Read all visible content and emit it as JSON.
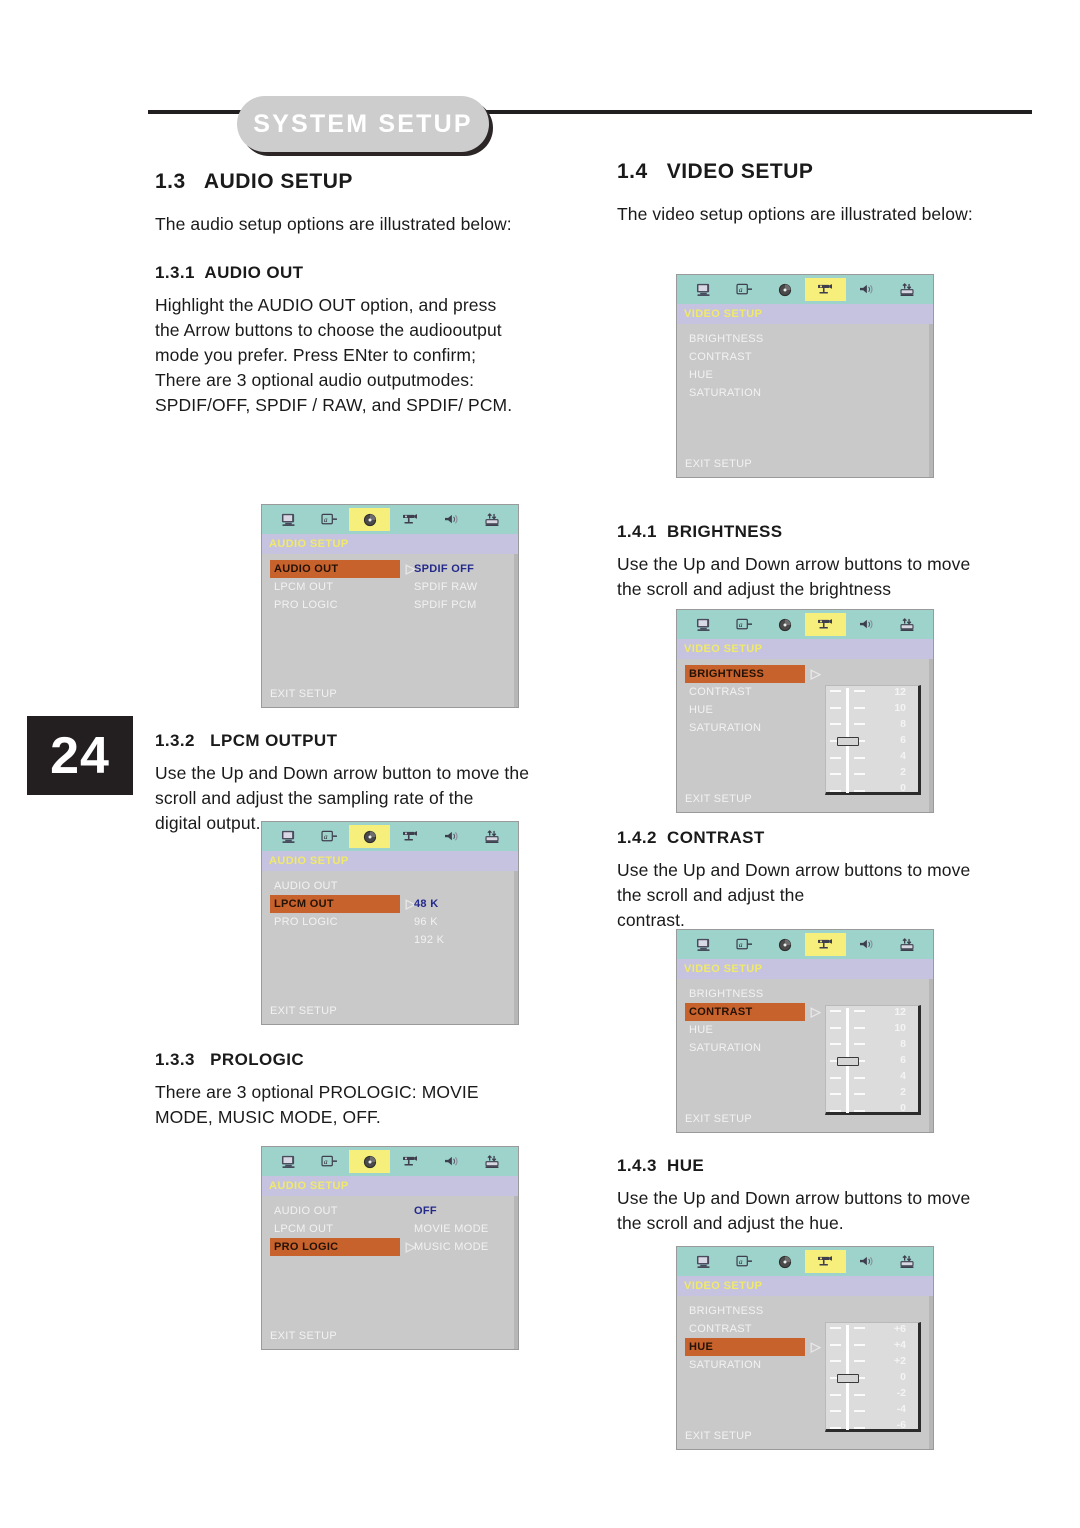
{
  "header": {
    "banner_title": "SYSTEM SETUP"
  },
  "page_number": "24",
  "left_column": {
    "section_title": "1.3   AUDIO SETUP",
    "intro": "The audio setup options are illustrated below:",
    "sub1": {
      "heading": "1.3.1  AUDIO OUT",
      "body": "Highlight the AUDIO OUT option, and press\nthe Arrow buttons to choose the audiooutput\nmode you prefer. Press ENter to confirm;\nThere are 3 optional audio outputmodes:\nSPDIF/OFF, SPDIF / RAW, and SPDIF/ PCM."
    },
    "sub2": {
      "heading": "1.3.2   LPCM OUTPUT",
      "body": "Use the Up and Down arrow button to move the\nscroll and adjust the sampling rate of the\ndigital output."
    },
    "sub3": {
      "heading": "1.3.3   PROLOGIC",
      "body": "There are 3 optional PROLOGIC: MOVIE\nMODE, MUSIC MODE, OFF."
    }
  },
  "right_column": {
    "section_title": "1.4   VIDEO SETUP",
    "intro": "The video setup options are illustrated below:",
    "sub1": {
      "heading": "1.4.1  BRIGHTNESS",
      "body": "Use the Up and Down arrow buttons to move\nthe scroll and adjust the brightness"
    },
    "sub2": {
      "heading": "1.4.2  CONTRAST",
      "body": "Use the Up and Down arrow buttons to move\nthe scroll and adjust the\ncontrast."
    },
    "sub3": {
      "heading": "1.4.3  HUE",
      "body": "Use the Up and Down arrow buttons  to move\nthe scroll and adjust the hue."
    }
  },
  "osd_common": {
    "icons": [
      "monitor-icon",
      "language-icon",
      "disc-icon",
      "camcorder-icon",
      "speaker-icon",
      "tuner-icon"
    ],
    "exit_label": "EXIT SETUP",
    "audio_title": "AUDIO SETUP",
    "video_title": "VIDEO SETUP"
  },
  "osd_screens": {
    "audio_out": {
      "title": "AUDIO SETUP",
      "active_icon_index": 2,
      "menu": [
        {
          "label": "AUDIO OUT",
          "highlighted": true,
          "caret": true
        },
        {
          "label": "LPCM OUT",
          "highlighted": false,
          "caret": false
        },
        {
          "label": "PRO LOGIC",
          "highlighted": false,
          "caret": false
        }
      ],
      "options": [
        {
          "label": "SPDIF OFF",
          "selected": true
        },
        {
          "label": "SPDIF RAW",
          "selected": false
        },
        {
          "label": "SPDIF PCM",
          "selected": false
        }
      ],
      "exit": "EXIT SETUP"
    },
    "lpcm_out": {
      "title": "AUDIO SETUP",
      "active_icon_index": 2,
      "menu": [
        {
          "label": "AUDIO OUT",
          "highlighted": false,
          "caret": false
        },
        {
          "label": "LPCM OUT",
          "highlighted": true,
          "caret": true
        },
        {
          "label": "PRO LOGIC",
          "highlighted": false,
          "caret": false
        }
      ],
      "options": [
        {
          "label": "",
          "selected": false
        },
        {
          "label": "48 K",
          "selected": true
        },
        {
          "label": "96 K",
          "selected": false
        },
        {
          "label": "192 K",
          "selected": false
        }
      ],
      "exit": "EXIT SETUP"
    },
    "pro_logic": {
      "title": "AUDIO SETUP",
      "active_icon_index": 2,
      "menu": [
        {
          "label": "AUDIO OUT",
          "highlighted": false,
          "caret": false
        },
        {
          "label": "LPCM OUT",
          "highlighted": false,
          "caret": false
        },
        {
          "label": "PRO LOGIC",
          "highlighted": true,
          "caret": true
        }
      ],
      "options": [
        {
          "label": "OFF",
          "selected": true
        },
        {
          "label": "MOVIE MODE",
          "selected": false
        },
        {
          "label": "MUSIC MODE",
          "selected": false
        }
      ],
      "exit": "EXIT SETUP"
    },
    "video_setup": {
      "title": "VIDEO SETUP",
      "active_icon_index": 3,
      "menu": [
        {
          "label": "BRIGHTNESS",
          "highlighted": false,
          "caret": false
        },
        {
          "label": "CONTRAST",
          "highlighted": false,
          "caret": false
        },
        {
          "label": "HUE",
          "highlighted": false,
          "caret": false
        },
        {
          "label": "SATURATION",
          "highlighted": false,
          "caret": false
        }
      ],
      "exit": "EXIT SETUP"
    },
    "brightness": {
      "title": "VIDEO SETUP",
      "active_icon_index": 3,
      "menu": [
        {
          "label": "BRIGHTNESS",
          "highlighted": true,
          "caret": true
        },
        {
          "label": "CONTRAST",
          "highlighted": false,
          "caret": false
        },
        {
          "label": "HUE",
          "highlighted": false,
          "caret": false
        },
        {
          "label": "SATURATION",
          "highlighted": false,
          "caret": false
        }
      ],
      "slider": {
        "labels": [
          "12",
          "10",
          "8",
          "6",
          "4",
          "2",
          "0"
        ],
        "thumb_index": 3
      },
      "exit": "EXIT SETUP"
    },
    "contrast": {
      "title": "VIDEO SETUP",
      "active_icon_index": 3,
      "menu": [
        {
          "label": "BRIGHTNESS",
          "highlighted": false,
          "caret": false
        },
        {
          "label": "CONTRAST",
          "highlighted": true,
          "caret": true
        },
        {
          "label": "HUE",
          "highlighted": false,
          "caret": false
        },
        {
          "label": "SATURATION",
          "highlighted": false,
          "caret": false
        }
      ],
      "slider": {
        "labels": [
          "12",
          "10",
          "8",
          "6",
          "4",
          "2",
          "0"
        ],
        "thumb_index": 3
      },
      "exit": "EXIT SETUP"
    },
    "hue": {
      "title": "VIDEO SETUP",
      "active_icon_index": 3,
      "menu": [
        {
          "label": "BRIGHTNESS",
          "highlighted": false,
          "caret": false
        },
        {
          "label": "CONTRAST",
          "highlighted": false,
          "caret": false
        },
        {
          "label": "HUE",
          "highlighted": true,
          "caret": true
        },
        {
          "label": "SATURATION",
          "highlighted": false,
          "caret": false
        }
      ],
      "slider": {
        "labels": [
          "+6",
          "+4",
          "+2",
          "0",
          "-2",
          "-4",
          "-6"
        ],
        "thumb_index": 3
      },
      "exit": "EXIT SETUP"
    }
  },
  "colors": {
    "osd_iconbar": "#9ed3cb",
    "osd_titlebar": "#c5c3df",
    "osd_title_text": "#f0e96a",
    "osd_body": "#c9c9c9",
    "highlight": "#c8622c",
    "selected_option": "#242a8c",
    "icon_active": "#f7ef7b",
    "banner": "#cdcdcd",
    "page_badge": "#231f20"
  }
}
